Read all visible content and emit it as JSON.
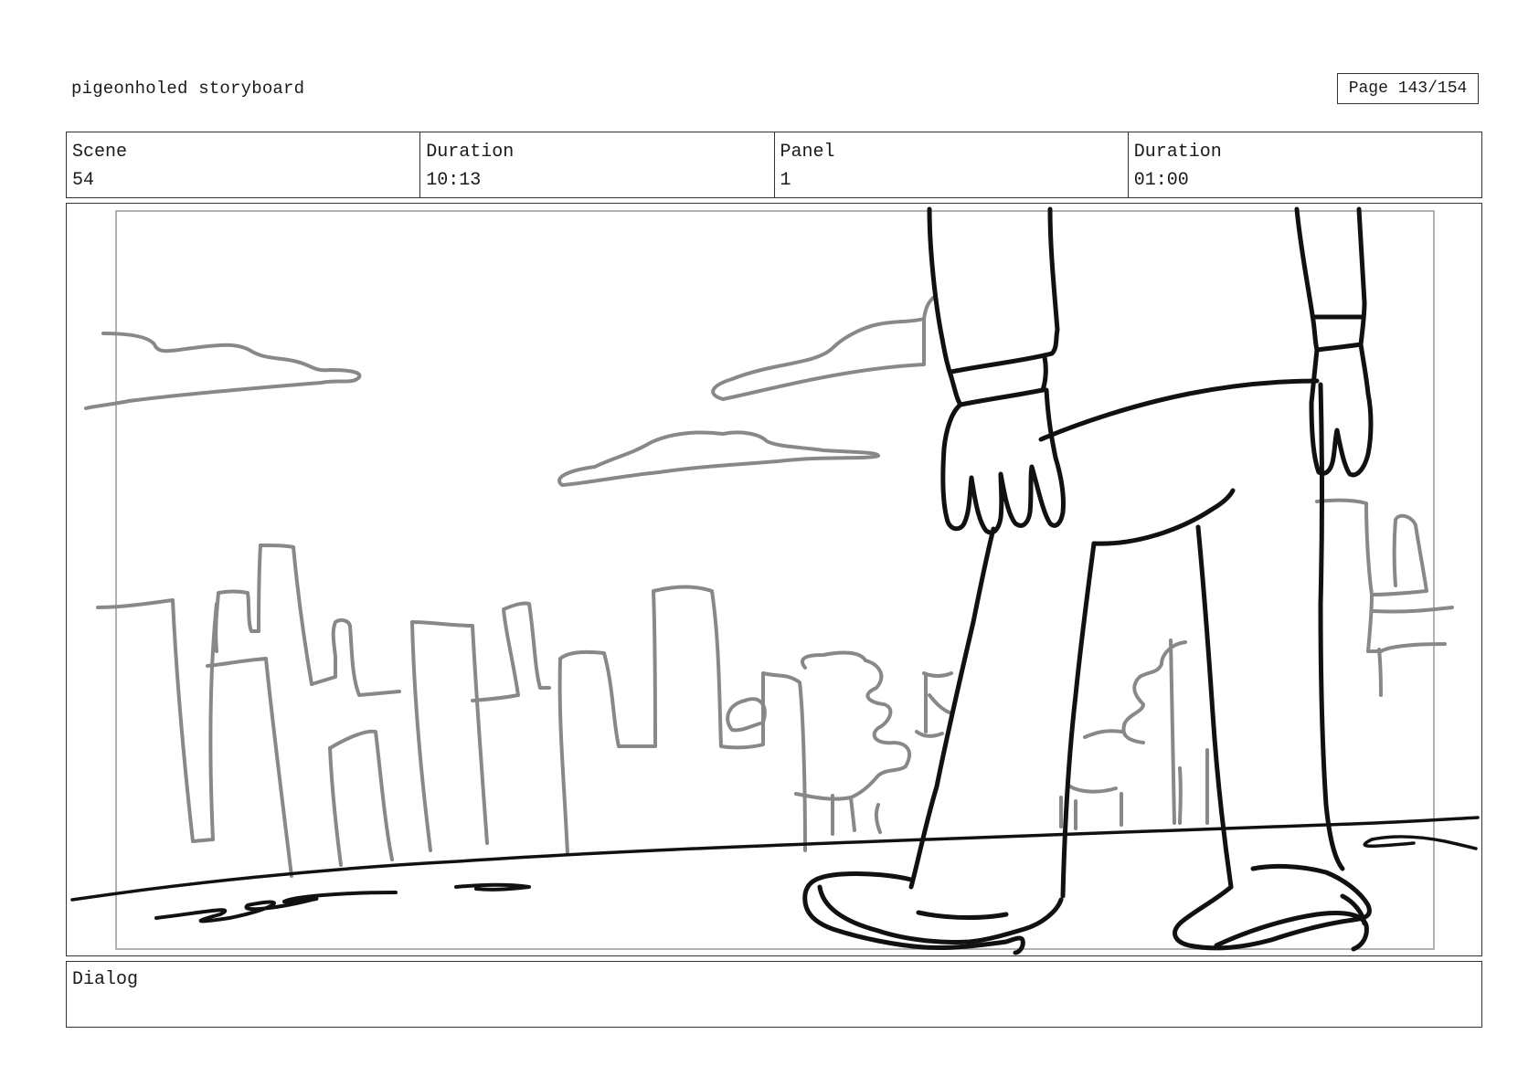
{
  "header": {
    "title": "pigeonholed storyboard",
    "page": "Page 143/154"
  },
  "info": {
    "scene_label": "Scene",
    "scene_value": "54",
    "duration_label": "Duration",
    "duration_value": "10:13",
    "panel_label": "Panel",
    "panel_value": "1",
    "panel_duration_label": "Duration",
    "panel_duration_value": "01:00"
  },
  "dialog": {
    "label": "Dialog"
  },
  "colors": {
    "line_dark": "#111111",
    "line_gray": "#888888",
    "border": "#333333"
  }
}
